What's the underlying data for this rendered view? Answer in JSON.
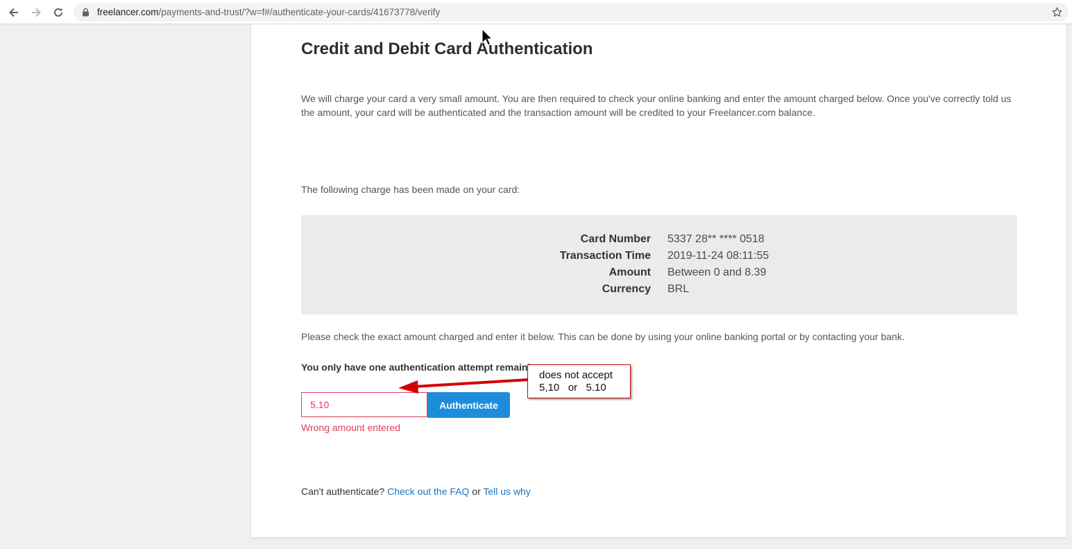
{
  "browser": {
    "url_host": "freelancer.com",
    "url_path": "/payments-and-trust/?w=f#/authenticate-your-cards/41673778/verify"
  },
  "page": {
    "title": "Credit and Debit Card Authentication",
    "intro": "We will charge your card a very small amount. You are then required to check your online banking and enter the amount charged below. Once you've correctly told us the amount, your card will be authenticated and the transaction amount will be credited to your Freelancer.com balance.",
    "charge_intro": "The following charge has been made on your card:",
    "details": [
      {
        "label": "Card Number",
        "value": "5337 28** **** 0518"
      },
      {
        "label": "Transaction Time",
        "value": "2019-11-24 08:11:55"
      },
      {
        "label": "Amount",
        "value": "Between 0 and 8.39"
      },
      {
        "label": "Currency",
        "value": "BRL"
      }
    ],
    "check_text": "Please check the exact amount charged and enter it below. This can be done by using your online banking portal or by contacting your bank.",
    "attempt_text": "You only have one authentication attempt remaining",
    "amount_value": "5.10",
    "authenticate_label": "Authenticate",
    "error_text": "Wrong amount entered",
    "footer": {
      "prefix": "Can't authenticate?",
      "faq_link": "Check out the FAQ",
      "or": "or",
      "tell_link": "Tell us why"
    }
  },
  "annotation": {
    "line1": "does not accept",
    "line2": "5,10   or   5.10"
  }
}
